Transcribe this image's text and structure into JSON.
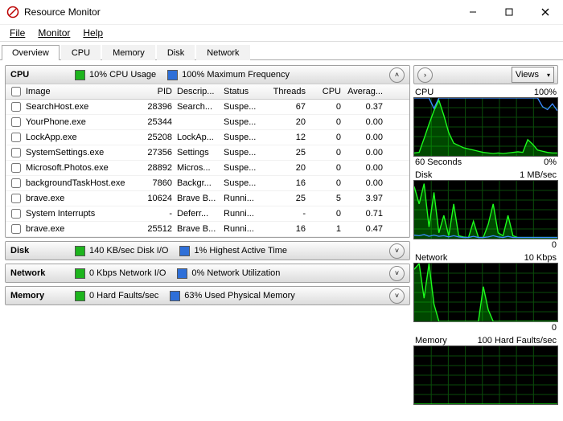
{
  "window": {
    "title": "Resource Monitor"
  },
  "menu": {
    "file": "File",
    "monitor": "Monitor",
    "help": "Help"
  },
  "tabs": {
    "overview": "Overview",
    "cpu": "CPU",
    "memory": "Memory",
    "disk": "Disk",
    "network": "Network"
  },
  "cpu_panel": {
    "title": "CPU",
    "metric1": "10% CPU Usage",
    "metric2": "100% Maximum Frequency",
    "headers": {
      "image": "Image",
      "pid": "PID",
      "desc": "Descrip...",
      "status": "Status",
      "threads": "Threads",
      "cpu": "CPU",
      "avg": "Averag..."
    },
    "rows": [
      {
        "img": "SearchHost.exe",
        "pid": "28396",
        "desc": "Search...",
        "status": "Suspe...",
        "threads": "67",
        "cpu": "0",
        "avg": "0.37",
        "link": true
      },
      {
        "img": "YourPhone.exe",
        "pid": "25344",
        "desc": "",
        "status": "Suspe...",
        "threads": "20",
        "cpu": "0",
        "avg": "0.00",
        "link": true
      },
      {
        "img": "LockApp.exe",
        "pid": "25208",
        "desc": "LockAp...",
        "status": "Suspe...",
        "threads": "12",
        "cpu": "0",
        "avg": "0.00",
        "link": true
      },
      {
        "img": "SystemSettings.exe",
        "pid": "27356",
        "desc": "Settings",
        "status": "Suspe...",
        "threads": "25",
        "cpu": "0",
        "avg": "0.00",
        "link": true
      },
      {
        "img": "Microsoft.Photos.exe",
        "pid": "28892",
        "desc": "Micros...",
        "status": "Suspe...",
        "threads": "20",
        "cpu": "0",
        "avg": "0.00",
        "link": true
      },
      {
        "img": "backgroundTaskHost.exe",
        "pid": "7860",
        "desc": "Backgr...",
        "status": "Suspe...",
        "threads": "16",
        "cpu": "0",
        "avg": "0.00",
        "link": true
      },
      {
        "img": "brave.exe",
        "pid": "10624",
        "desc": "Brave B...",
        "status": "Runni...",
        "threads": "25",
        "cpu": "5",
        "avg": "3.97",
        "link": false
      },
      {
        "img": "System Interrupts",
        "pid": "-",
        "desc": "Deferr...",
        "status": "Runni...",
        "threads": "-",
        "cpu": "0",
        "avg": "0.71",
        "link": false
      },
      {
        "img": "brave.exe",
        "pid": "25512",
        "desc": "Brave B...",
        "status": "Runni...",
        "threads": "16",
        "cpu": "1",
        "avg": "0.47",
        "link": false
      }
    ]
  },
  "disk_panel": {
    "title": "Disk",
    "metric1": "140 KB/sec Disk I/O",
    "metric2": "1% Highest Active Time"
  },
  "network_panel": {
    "title": "Network",
    "metric1": "0 Kbps Network I/O",
    "metric2": "0% Network Utilization"
  },
  "memory_panel": {
    "title": "Memory",
    "metric1": "0 Hard Faults/sec",
    "metric2": "63% Used Physical Memory"
  },
  "right": {
    "views": "Views",
    "cpu": {
      "top_left": "CPU",
      "top_right": "100%",
      "bottom_left": "60 Seconds",
      "bottom_right": "0%"
    },
    "disk": {
      "top_left": "Disk",
      "top_right": "1 MB/sec",
      "bottom_right": "0"
    },
    "network": {
      "top_left": "Network",
      "top_right": "10 Kbps",
      "bottom_right": "0"
    },
    "memory": {
      "top_left": "Memory",
      "top_right": "100 Hard Faults/sec"
    }
  },
  "chart_data": [
    {
      "type": "line",
      "title": "CPU",
      "ylim": [
        0,
        100
      ],
      "xspan_seconds": 60,
      "series": [
        {
          "name": "CPU Usage",
          "color": "#1dff1d",
          "values": [
            5,
            6,
            30,
            55,
            78,
            96,
            70,
            40,
            22,
            18,
            14,
            12,
            10,
            8,
            6,
            5,
            4,
            5,
            4,
            5,
            6,
            7,
            6,
            28,
            20,
            10,
            8,
            6,
            5,
            5
          ]
        },
        {
          "name": "Maximum Frequency",
          "color": "#3b8bff",
          "values": [
            100,
            100,
            100,
            100,
            82,
            100,
            100,
            100,
            100,
            100,
            100,
            100,
            100,
            100,
            100,
            100,
            100,
            100,
            100,
            100,
            100,
            100,
            100,
            100,
            100,
            100,
            85,
            80,
            90,
            78
          ]
        }
      ]
    },
    {
      "type": "line",
      "title": "Disk",
      "yunit": "MB/sec",
      "ylim": [
        0,
        1
      ],
      "xspan_seconds": 60,
      "series": [
        {
          "name": "Disk I/O",
          "color": "#1dff1d",
          "values": [
            0.9,
            0.6,
            0.95,
            0.2,
            0.8,
            0.1,
            0.4,
            0.05,
            0.6,
            0.05,
            0.03,
            0.02,
            0.3,
            0.02,
            0.02,
            0.25,
            0.6,
            0.1,
            0.05,
            0.4,
            0.05,
            0.02,
            0.02,
            0.02,
            0.02,
            0.02,
            0.02,
            0.02,
            0.02,
            0.02
          ]
        },
        {
          "name": "Highest Active Time",
          "color": "#3b8bff",
          "values": [
            0.06,
            0.05,
            0.07,
            0.04,
            0.06,
            0.04,
            0.05,
            0.03,
            0.05,
            0.03,
            0.02,
            0.02,
            0.04,
            0.02,
            0.02,
            0.03,
            0.05,
            0.03,
            0.02,
            0.04,
            0.02,
            0.02,
            0.02,
            0.02,
            0.02,
            0.02,
            0.02,
            0.02,
            0.02,
            0.02
          ]
        }
      ]
    },
    {
      "type": "line",
      "title": "Network",
      "yunit": "Kbps",
      "ylim": [
        0,
        10
      ],
      "xspan_seconds": 60,
      "series": [
        {
          "name": "Network I/O",
          "color": "#1dff1d",
          "values": [
            9,
            10,
            4,
            10,
            3,
            0,
            0,
            0,
            0,
            0,
            0,
            0,
            0,
            0,
            6,
            2,
            0,
            0,
            0,
            0,
            0,
            0,
            0,
            0,
            0,
            0,
            0,
            0,
            0,
            0
          ]
        }
      ]
    },
    {
      "type": "line",
      "title": "Memory",
      "yunit": "Hard Faults/sec",
      "ylim": [
        0,
        100
      ],
      "xspan_seconds": 60,
      "series": [
        {
          "name": "Hard Faults",
          "color": "#1dff1d",
          "values": [
            0,
            0,
            0,
            0,
            0,
            0,
            0,
            0,
            0,
            0,
            0,
            0,
            0,
            0,
            0,
            0,
            0,
            0,
            0,
            0,
            0,
            0,
            0,
            0,
            0,
            0,
            0,
            0,
            0,
            0
          ]
        }
      ]
    }
  ]
}
